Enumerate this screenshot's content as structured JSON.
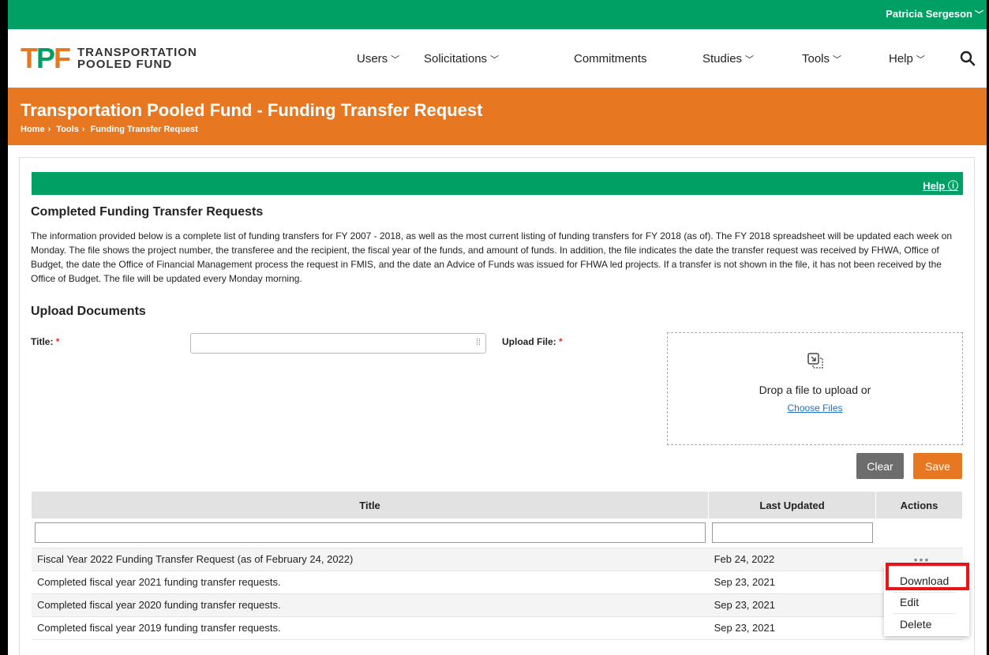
{
  "user": {
    "name": "Patricia Sergeson"
  },
  "brand": {
    "logo_letters": "TPF",
    "line1": "TRANSPORTATION",
    "line2": "POOLED FUND"
  },
  "nav": {
    "users": "Users",
    "solicitations": "Solicitations",
    "commitments": "Commitments",
    "studies": "Studies",
    "tools": "Tools",
    "help": "Help"
  },
  "page": {
    "title": "Transportation Pooled Fund - Funding Transfer Request",
    "breadcrumb": [
      "Home",
      "Tools",
      "Funding Transfer Request"
    ]
  },
  "panel": {
    "help_label": "Help",
    "heading": "Completed Funding Transfer Requests",
    "description": "The information provided below is a complete list of funding transfers for FY 2007 - 2018, as well as the most current listing of funding transfers for FY 2018 (as of). The FY 2018 spreadsheet will be updated each week on Monday. The file shows the project number, the transferee and the recipient, the fiscal year of the funds, and amount of funds. In addition, the file indicates the date the transfer request was received by FHWA, Office of Budget, the date the Office of Financial Management process the request in FMIS, and the date an Advice of Funds was issued for FHWA led projects. If a transfer is not shown in the file, it has not been received by the Office of Budget. The file will be updated every Monday morning.",
    "upload_heading": "Upload Documents",
    "title_label": "Title:",
    "upload_label": "Upload File:",
    "required_mark": "*",
    "drop_text": "Drop a file to upload or",
    "choose_files": "Choose Files",
    "clear": "Clear",
    "save": "Save"
  },
  "table": {
    "headers": [
      "Title",
      "Last Updated",
      "Actions"
    ],
    "rows": [
      {
        "title": "Fiscal Year 2022 Funding Transfer Request (as of February 24, 2022)",
        "date": "Feb 24, 2022"
      },
      {
        "title": "Completed fiscal year 2021 funding transfer requests.",
        "date": "Sep 23, 2021"
      },
      {
        "title": "Completed fiscal year 2020 funding transfer requests.",
        "date": "Sep 23, 2021"
      },
      {
        "title": "Completed fiscal year 2019 funding transfer requests.",
        "date": "Sep 23, 2021"
      }
    ],
    "actions_glyph": "•••"
  },
  "action_menu": {
    "download": "Download",
    "edit": "Edit",
    "delete": "Delete"
  },
  "colors": {
    "green": "#00a065",
    "orange": "#e87722",
    "gray_button": "#6d6d6d",
    "highlight": "#e8141b"
  }
}
